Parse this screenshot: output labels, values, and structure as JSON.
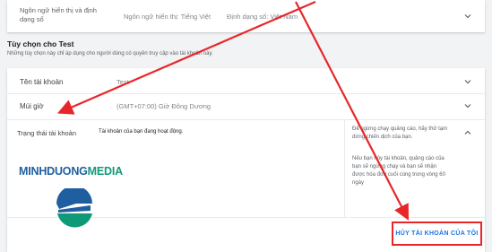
{
  "top_row": {
    "label": "Ngôn ngữ hiển thị và định dạng số",
    "language_value": "Ngôn ngữ hiển thị: Tiếng Việt",
    "format_value": "Định dạng số: Việt Nam"
  },
  "section": {
    "title": "Tùy chọn cho Test",
    "subtitle": "Những tùy chọn này chỉ áp dụng cho người dùng có quyền truy cập vào tài khoản này."
  },
  "account_name": {
    "label": "Tên tài khoản",
    "value": "Test"
  },
  "timezone": {
    "label": "Múi giờ",
    "value": "(GMT+07:00) Giờ Đông Dương"
  },
  "status": {
    "label": "Trạng thái tài khoản",
    "value": "Tài khoản của bạn đang hoạt động.",
    "help_p1": "Để ngừng chạy quảng cáo, hãy thử tạm dừng chiến dịch của bạn.",
    "help_p2": "Nếu bạn hủy tài khoản, quảng cáo của bạn sẽ ngừng chạy và bạn sẽ nhận được hóa đơn cuối cùng trong vòng 60 ngày"
  },
  "cancel_button": {
    "label": "HỦY TÀI KHOẢN CỦA TÔI"
  },
  "watermark": {
    "text_main": "MINHDUONG",
    "text_accent": "MEDIA"
  },
  "colors": {
    "accent_blue": "#1a73e8",
    "annotation_red": "#e8262a",
    "logo_blue": "#1f5fa0",
    "logo_green": "#0f9a77"
  },
  "icons": [
    "chevron-down-icon",
    "chevron-up-icon",
    "minhduong-logo-icon"
  ]
}
